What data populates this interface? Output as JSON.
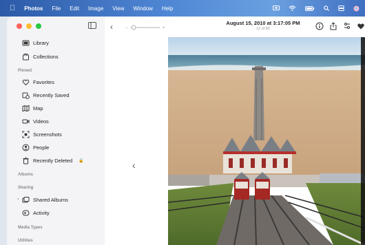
{
  "menubar": {
    "app_name": "Photos",
    "menus": [
      "File",
      "Edit",
      "Image",
      "View",
      "Window",
      "Help"
    ]
  },
  "sidebar": {
    "top_items": [
      {
        "label": "Library",
        "icon": "library-icon"
      },
      {
        "label": "Collections",
        "icon": "collections-icon"
      }
    ],
    "pinned_header": "Pinned",
    "pinned_items": [
      {
        "label": "Favorites",
        "icon": "heart-icon"
      },
      {
        "label": "Recently Saved",
        "icon": "recently-saved-icon"
      },
      {
        "label": "Map",
        "icon": "map-icon"
      },
      {
        "label": "Videos",
        "icon": "video-icon"
      },
      {
        "label": "Screenshots",
        "icon": "screenshot-icon"
      },
      {
        "label": "People",
        "icon": "person-icon"
      },
      {
        "label": "Recently Deleted",
        "icon": "trash-icon"
      }
    ],
    "albums_header": "Albums",
    "sharing_header": "Sharing",
    "sharing_items": [
      {
        "label": "Shared Albums",
        "icon": "shared-albums-icon"
      },
      {
        "label": "Activity",
        "icon": "activity-icon"
      }
    ],
    "media_types_header": "Media Types",
    "utilities_header": "Utilities"
  },
  "toolbar": {
    "photo_date": "August 15, 2010 at 3:17:05 PM",
    "photo_count": "12 of 80"
  },
  "colors": {
    "close": "#ff5f57",
    "minimize": "#febc2e",
    "maximize": "#28c840"
  }
}
